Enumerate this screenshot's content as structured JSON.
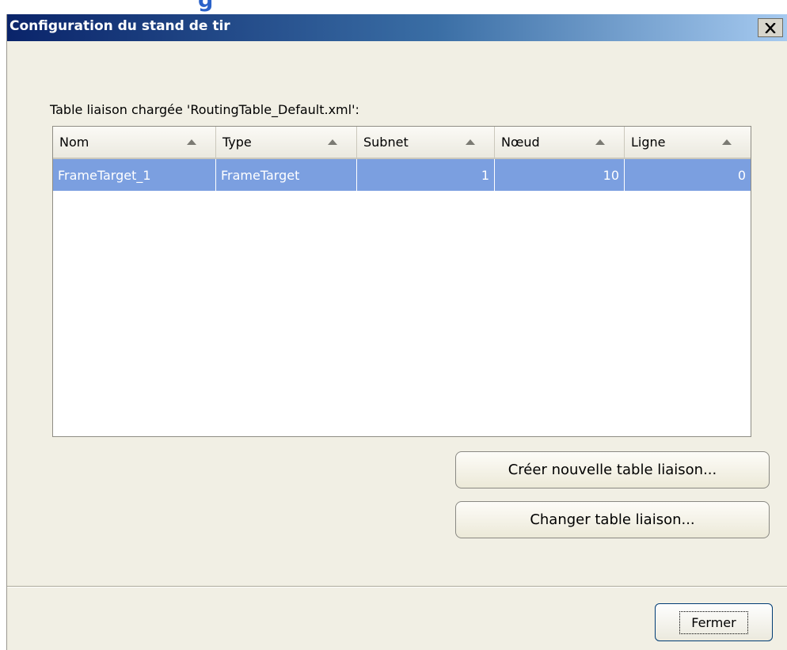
{
  "background_title_fragment": "g",
  "window": {
    "title": "Configuration du stand de tir",
    "close_icon": "close-icon"
  },
  "table": {
    "caption": "Table liaison chargée 'RoutingTable_Default.xml':",
    "columns": [
      "Nom",
      "Type",
      "Subnet",
      "Nœud",
      "Ligne"
    ],
    "sort_icon": "sort-asc-icon",
    "rows": [
      {
        "nom": "FrameTarget_1",
        "type": "FrameTarget",
        "subnet": "1",
        "noeud": "10",
        "ligne": "0"
      }
    ],
    "selected_row_color": "#7b9fe0"
  },
  "buttons": {
    "create_table": "Créer nouvelle table liaison...",
    "change_table": "Changer table liaison...",
    "close": "Fermer"
  },
  "colors": {
    "titlebar_start": "#0a246a",
    "titlebar_end": "#a6caf0",
    "window_bg": "#f1efe4"
  }
}
